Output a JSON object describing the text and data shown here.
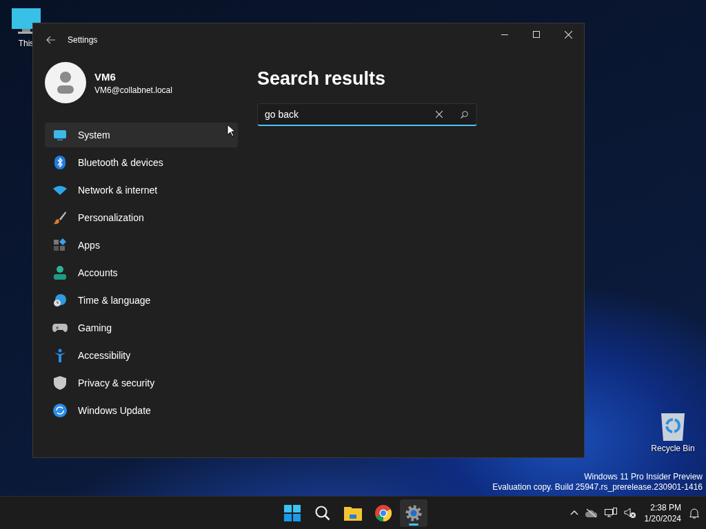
{
  "desktop_icons": [
    {
      "label": "This"
    },
    {
      "label": "Recycle Bin"
    }
  ],
  "window": {
    "title": "Settings"
  },
  "profile": {
    "name": "VM6",
    "email": "VM6@collabnet.local"
  },
  "sidebar": {
    "items": [
      {
        "label": "System",
        "selected": true
      },
      {
        "label": "Bluetooth & devices",
        "selected": false
      },
      {
        "label": "Network & internet",
        "selected": false
      },
      {
        "label": "Personalization",
        "selected": false
      },
      {
        "label": "Apps",
        "selected": false
      },
      {
        "label": "Accounts",
        "selected": false
      },
      {
        "label": "Time & language",
        "selected": false
      },
      {
        "label": "Gaming",
        "selected": false
      },
      {
        "label": "Accessibility",
        "selected": false
      },
      {
        "label": "Privacy & security",
        "selected": false
      },
      {
        "label": "Windows Update",
        "selected": false
      }
    ]
  },
  "content": {
    "heading": "Search results",
    "search": {
      "value": "go back"
    }
  },
  "watermark": {
    "line_1": "Windows 11 Pro Insider Preview",
    "line_2": "Evaluation copy. Build 25947.rs_prerelease.230901-1416"
  },
  "taskbar": {
    "apps": [
      {
        "active": false
      },
      {
        "active": false
      },
      {
        "active": false
      },
      {
        "active": false
      },
      {
        "active": true
      }
    ],
    "clock": {
      "time": "2:38 PM",
      "date": "1/20/2024"
    }
  }
}
